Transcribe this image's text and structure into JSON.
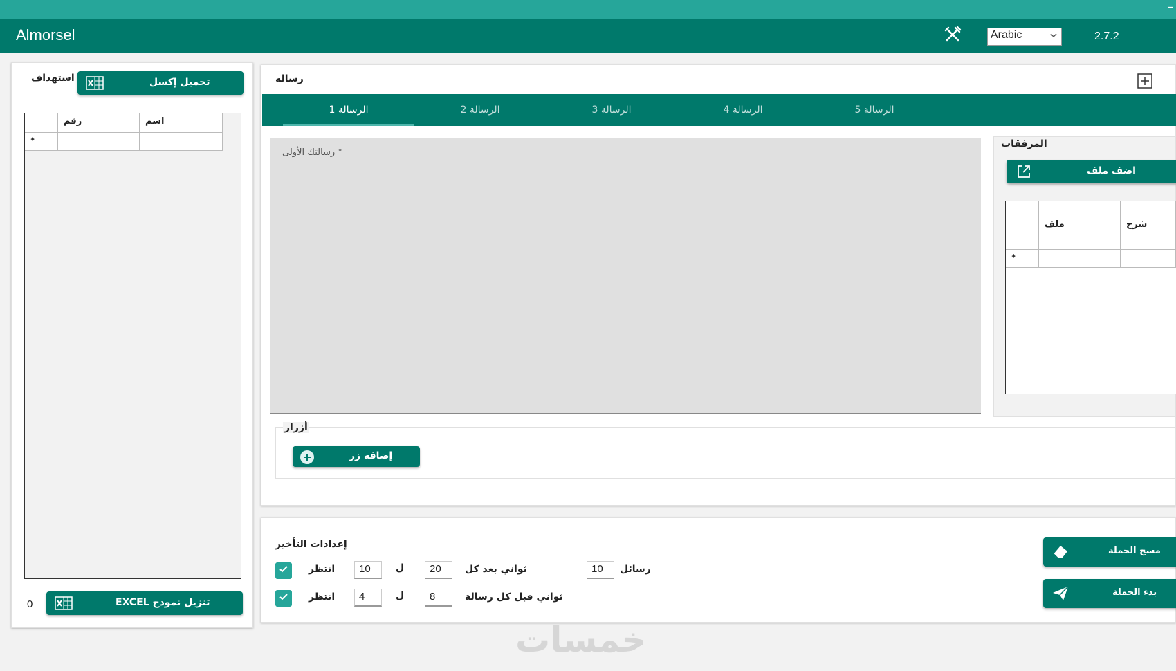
{
  "window": {
    "minimize_glyph": "–"
  },
  "header": {
    "app_title": "Almorsel",
    "language": "Arabic",
    "version": "2.7.2",
    "tools_icon": "tools-icon",
    "bg_color": "#00796b"
  },
  "targeting": {
    "title": "استهداف",
    "load_excel_label": "تحميل إكسل",
    "grid": {
      "columns": [
        "رقم",
        "اسم"
      ],
      "new_row_marker": "*"
    },
    "count": "0",
    "download_template_label": "EXCEL تنزيل نموذج"
  },
  "message": {
    "title": "رسالة",
    "tabs": [
      "الرسالة 1",
      "الرسالة 2",
      "الرسالة 3",
      "الرسالة 4",
      "الرسالة 5"
    ],
    "active_tab": 0,
    "placeholder": "رسالتك الأولى *",
    "attachments": {
      "title": "المرفقات",
      "add_file_label": "اضف ملف",
      "grid": {
        "columns": [
          "ملف",
          "شرح"
        ],
        "new_row_marker": "*"
      }
    },
    "buttons": {
      "title": "أزرار",
      "add_button_label": "إضافة زر"
    }
  },
  "delay": {
    "title": "إعدادات التأخير",
    "row1": {
      "wait_label": "انتظر",
      "from": "10",
      "to_label": "ل",
      "to": "20",
      "unit": "ثواني بعد كل",
      "count": "10",
      "count_label": "رسائل",
      "checked": true
    },
    "row2": {
      "wait_label": "انتظر",
      "from": "4",
      "to_label": "ل",
      "to": "8",
      "unit": "ثواني قبل كل رسالة",
      "checked": true
    }
  },
  "campaign": {
    "clear_label": "مسح الحملة",
    "start_label": "بدء الحملة"
  },
  "watermark": "خمسات"
}
